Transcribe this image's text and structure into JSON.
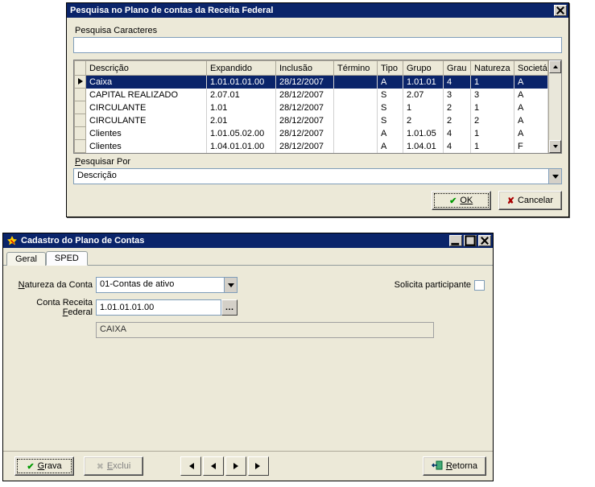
{
  "search_dialog": {
    "title": "Pesquisa no Plano de contas da Receita Federal",
    "chars_label": "Pesquisa Caracteres",
    "chars_value": "",
    "columns": [
      "Descrição",
      "Expandido",
      "Inclusão",
      "Término",
      "Tipo",
      "Grupo",
      "Grau",
      "Natureza",
      "Societária/Fiscal"
    ],
    "rows": [
      {
        "sel": true,
        "desc": "Caixa",
        "exp": "1.01.01.01.00",
        "inc": "28/12/2007",
        "term": "",
        "tipo": "A",
        "grupo": "1.01.01",
        "grau": "4",
        "nat": "1",
        "soc": "A"
      },
      {
        "sel": false,
        "desc": "CAPITAL REALIZADO",
        "exp": "2.07.01",
        "inc": "28/12/2007",
        "term": "",
        "tipo": "S",
        "grupo": "2.07",
        "grau": "3",
        "nat": "3",
        "soc": "A"
      },
      {
        "sel": false,
        "desc": "CIRCULANTE",
        "exp": "1.01",
        "inc": "28/12/2007",
        "term": "",
        "tipo": "S",
        "grupo": "1",
        "grau": "2",
        "nat": "1",
        "soc": "A"
      },
      {
        "sel": false,
        "desc": "CIRCULANTE",
        "exp": "2.01",
        "inc": "28/12/2007",
        "term": "",
        "tipo": "S",
        "grupo": "2",
        "grau": "2",
        "nat": "2",
        "soc": "A"
      },
      {
        "sel": false,
        "desc": "Clientes",
        "exp": "1.01.05.02.00",
        "inc": "28/12/2007",
        "term": "",
        "tipo": "A",
        "grupo": "1.01.05",
        "grau": "4",
        "nat": "1",
        "soc": "A"
      },
      {
        "sel": false,
        "desc": "Clientes",
        "exp": "1.04.01.01.00",
        "inc": "28/12/2007",
        "term": "",
        "tipo": "A",
        "grupo": "1.04.01",
        "grau": "4",
        "nat": "1",
        "soc": "F"
      }
    ],
    "search_by_label": "Pesquisar Por",
    "search_by_value": "Descrição",
    "ok_label": "OK",
    "cancel_label": "Cancelar"
  },
  "main_window": {
    "title": "Cadastro do Plano de Contas",
    "tabs": {
      "geral": "Geral",
      "sped": "SPED"
    },
    "fields": {
      "natureza_label": "Natureza da Conta",
      "natureza_value": "01-Contas de ativo",
      "solicita_label": "Solicita participante",
      "conta_label": "Conta Receita Federal",
      "conta_value": "1.01.01.01.00",
      "conta_desc": "CAIXA"
    },
    "buttons": {
      "grava": "Grava",
      "exclui": "Exclui",
      "retorna": "Retorna"
    }
  }
}
